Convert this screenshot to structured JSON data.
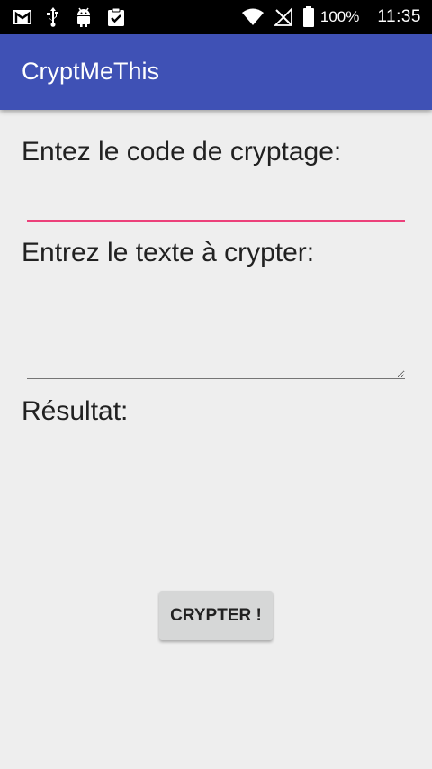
{
  "status_bar": {
    "left_icons": [
      "gmail-icon",
      "usb-icon",
      "android-debug-icon",
      "clipboard-check-icon"
    ],
    "right_icons": [
      "wifi-icon",
      "no-signal-icon",
      "battery-icon"
    ],
    "battery_percent": "100%",
    "time": "11:35"
  },
  "app_bar": {
    "title": "CryptMeThis",
    "color": "#3f51b5"
  },
  "form": {
    "code_label": "Entez le code de cryptage:",
    "code_value": "",
    "text_label": "Entrez le texte à crypter:",
    "text_value": "",
    "result_label": "Résultat:",
    "result_value": "",
    "button_label": "CRYPTER !",
    "accent_color": "#ec407a"
  }
}
